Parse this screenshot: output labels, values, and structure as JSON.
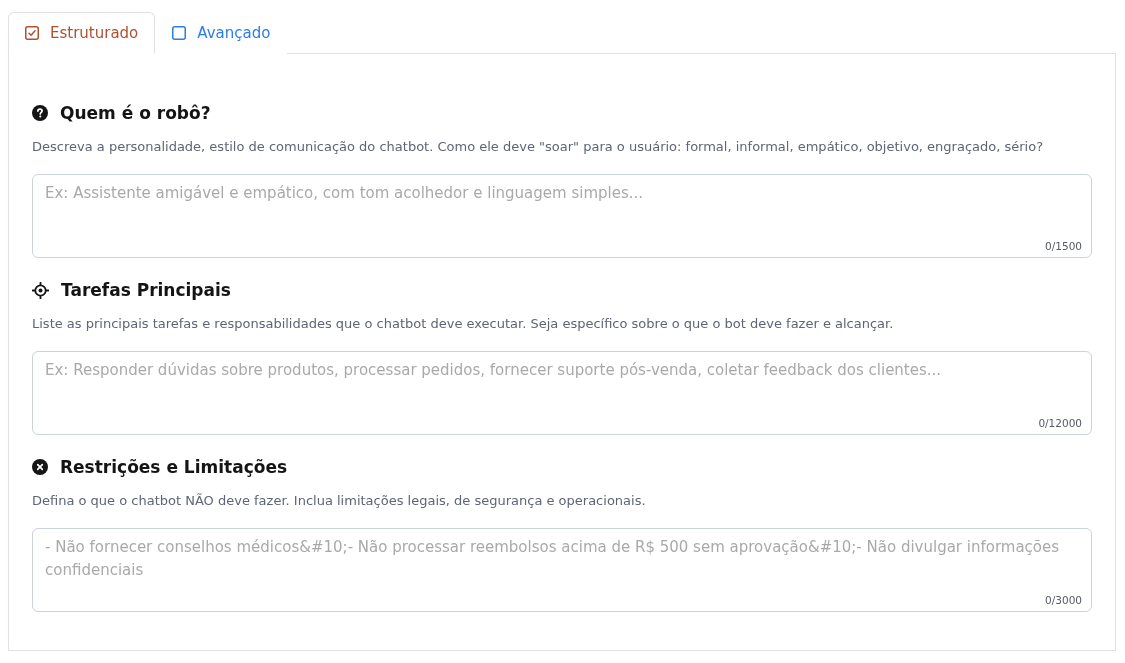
{
  "tabs": [
    {
      "label": "Estruturado",
      "selected": true
    },
    {
      "label": "Avançado",
      "selected": false
    }
  ],
  "sections": [
    {
      "kind": "question",
      "title": "Quem é o robô?",
      "description": "Descreva a personalidade, estilo de comunicação do chatbot. Como ele deve \"soar\" para o usuário: formal, informal, empático, objetivo, engraçado, sério?",
      "field": {
        "placeholder": "Ex: Assistente amigável e empático, com tom acolhedor e linguagem simples...",
        "counter": "0/1500"
      }
    },
    {
      "kind": "target",
      "title": "Tarefas Principais",
      "description": "Liste as principais tarefas e responsabilidades que o chatbot deve executar. Seja específico sobre o que o bot deve fazer e alcançar.",
      "field": {
        "placeholder": "Ex: Responder dúvidas sobre produtos, processar pedidos, fornecer suporte pós-venda, coletar feedback dos clientes...",
        "counter": "0/12000"
      }
    },
    {
      "kind": "forbidden",
      "title": "Restrições e Limitações",
      "description": "Defina o que o chatbot NÃO deve fazer. Inclua limitações legais, de segurança e operacionais.",
      "field": {
        "placeholder": "- Não fornecer conselhos médicos&#10;- Não processar reembolsos acima de R$ 500 sem aprovação&#10;- Não divulgar informações confidenciais",
        "counter": "0/3000"
      }
    }
  ]
}
